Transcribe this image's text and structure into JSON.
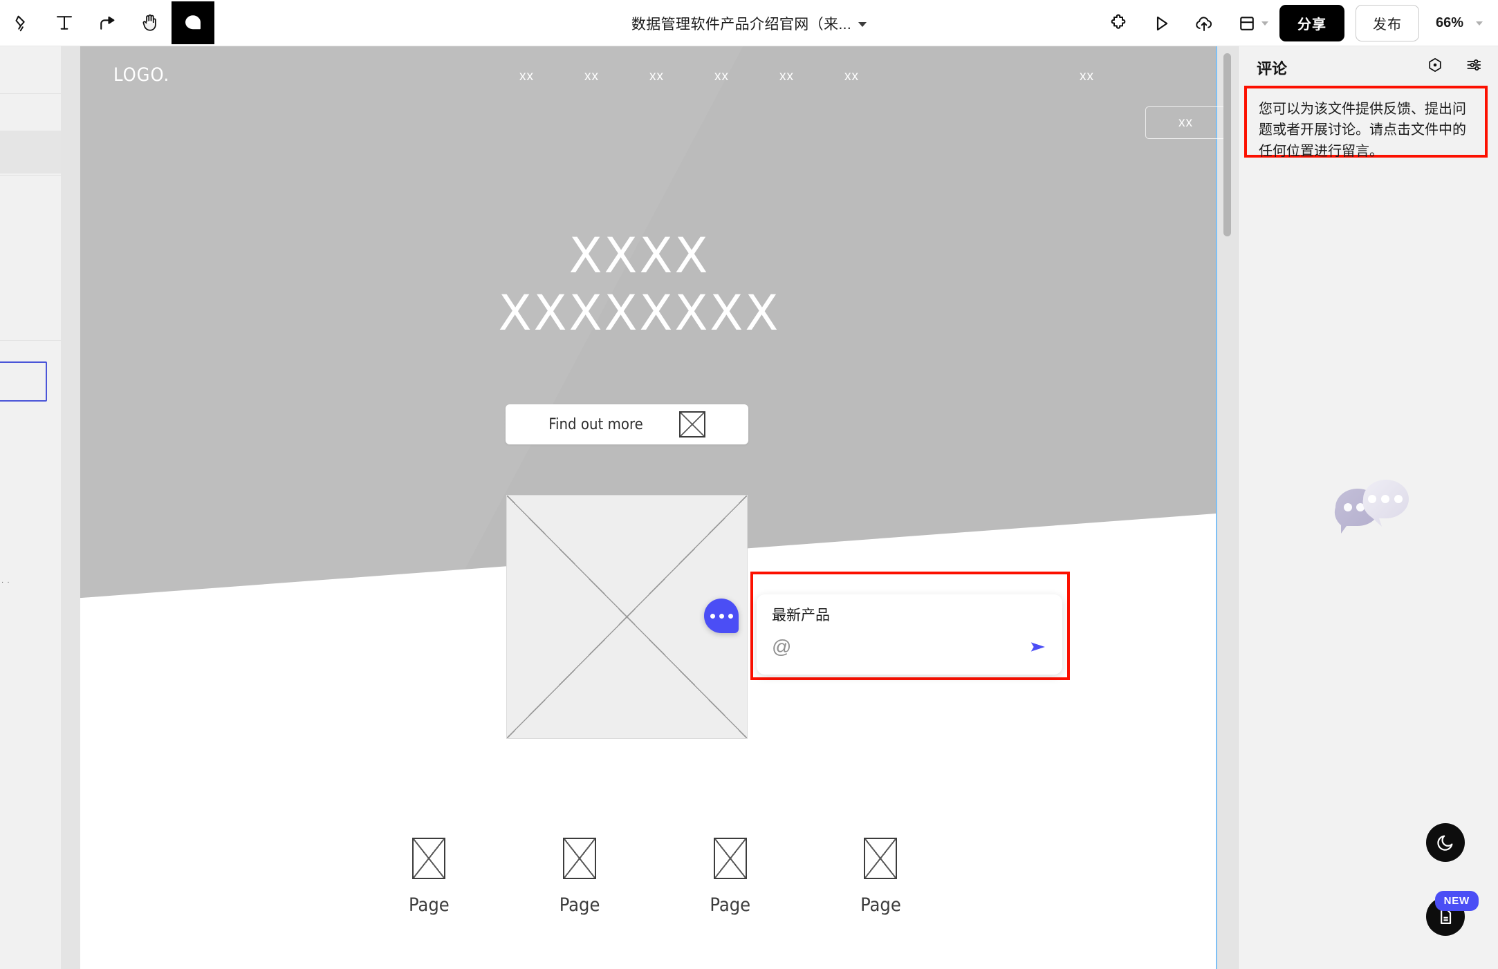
{
  "topbar": {
    "tools": [
      {
        "name": "pen-tool-icon",
        "label": "Pen",
        "active": false
      },
      {
        "name": "text-tool-icon",
        "label": "Text",
        "active": false
      },
      {
        "name": "flow-tool-icon",
        "label": "Flow",
        "active": false
      },
      {
        "name": "hand-tool-icon",
        "label": "Hand",
        "active": false
      },
      {
        "name": "comment-tool-icon",
        "label": "Comment",
        "active": true
      }
    ],
    "title": "数据管理软件产品介绍官网（来...",
    "title_caret": "chevron-down-icon",
    "right_icons": [
      {
        "name": "plugin-icon",
        "label": "Plugins"
      },
      {
        "name": "play-icon",
        "label": "Preview"
      },
      {
        "name": "cloud-upload-icon",
        "label": "Upload"
      },
      {
        "name": "layout-panel-icon",
        "label": "Layout"
      }
    ],
    "share_label": "分享",
    "publish_label": "发布",
    "zoom_level": "66%"
  },
  "site": {
    "logo": "LOGO.",
    "nav_center": [
      "xx",
      "xx",
      "xx",
      "xx",
      "xx",
      "xx"
    ],
    "nav_right": "xx",
    "nav_cta": "xx",
    "hero_title_line1": "XXXX",
    "hero_title_line2": "XXXXXXXX",
    "cta_label": "Find out more",
    "cta_icon": "image-placeholder-icon",
    "hero_placeholder_icon": "image-placeholder-icon",
    "pages": [
      {
        "label": "Page",
        "icon": "image-placeholder-icon"
      },
      {
        "label": "Page",
        "icon": "image-placeholder-icon"
      },
      {
        "label": "Page",
        "icon": "image-placeholder-icon"
      },
      {
        "label": "Page",
        "icon": "image-placeholder-icon"
      }
    ]
  },
  "comment_composer": {
    "pin_icon": "comment-bubble-icon",
    "text_value": "最新产品",
    "text_placeholder": "最新产品",
    "mention_icon": "at-mention-icon",
    "send_icon": "send-icon"
  },
  "comment_panel": {
    "title": "评论",
    "actions": [
      {
        "name": "resolve-toggle-icon",
        "label": "Resolved"
      },
      {
        "name": "filter-settings-icon",
        "label": "Filter"
      }
    ],
    "hint": "您可以为该文件提供反馈、提出问题或者开展讨论。请点击文件中的任何位置进行留言。",
    "illustration_icon": "chat-bubbles-illustration"
  },
  "fabs": [
    {
      "name": "dark-mode-toggle",
      "icon": "moon-icon"
    },
    {
      "name": "release-notes-button",
      "icon": "document-icon",
      "badge": "NEW"
    }
  ],
  "colors": {
    "accent_blue": "#4b4ef5",
    "highlight_red": "#fc1000",
    "artboard_border": "#2196f3",
    "hero_gray": "#bbbbbb"
  }
}
